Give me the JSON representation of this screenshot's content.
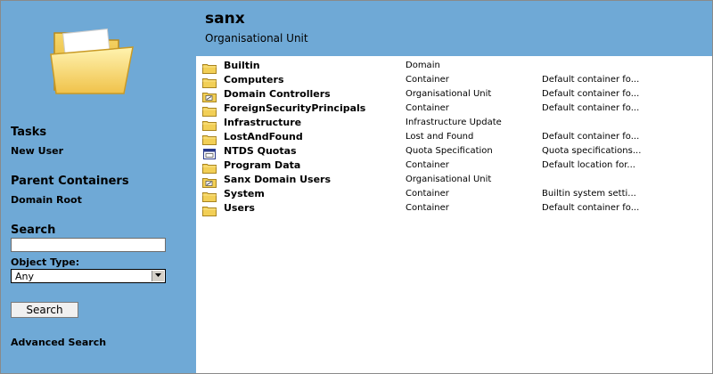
{
  "header": {
    "title": "sanx",
    "subtitle": "Organisational Unit"
  },
  "sidebar": {
    "tasks_heading": "Tasks",
    "new_user": "New User",
    "parent_heading": "Parent Containers",
    "domain_root": "Domain Root",
    "search_heading": "Search",
    "search_value": "",
    "object_type_label": "Object Type:",
    "object_type_value": "Any",
    "search_button": "Search",
    "advanced_search": "Advanced Search"
  },
  "objects": [
    {
      "name": "Builtin",
      "type": "Domain",
      "desc": "",
      "icon": "folder-icon"
    },
    {
      "name": "Computers",
      "type": "Container",
      "desc": "Default container fo...",
      "icon": "folder-icon"
    },
    {
      "name": "Domain Controllers",
      "type": "Organisational Unit",
      "desc": "Default container fo...",
      "icon": "ou-folder-icon"
    },
    {
      "name": "ForeignSecurityPrincipals",
      "type": "Container",
      "desc": "Default container fo...",
      "icon": "folder-icon"
    },
    {
      "name": "Infrastructure",
      "type": "Infrastructure Update",
      "desc": "",
      "icon": "folder-icon"
    },
    {
      "name": "LostAndFound",
      "type": "Lost and Found",
      "desc": "Default container fo...",
      "icon": "folder-icon"
    },
    {
      "name": "NTDS Quotas",
      "type": "Quota Specification",
      "desc": "Quota specifications...",
      "icon": "quota-icon"
    },
    {
      "name": "Program Data",
      "type": "Container",
      "desc": "Default location for...",
      "icon": "folder-icon"
    },
    {
      "name": "Sanx Domain Users",
      "type": "Organisational Unit",
      "desc": "",
      "icon": "ou-folder-icon"
    },
    {
      "name": "System",
      "type": "Container",
      "desc": "Builtin system setti...",
      "icon": "folder-icon"
    },
    {
      "name": "Users",
      "type": "Container",
      "desc": "Default container fo...",
      "icon": "folder-icon"
    }
  ]
}
